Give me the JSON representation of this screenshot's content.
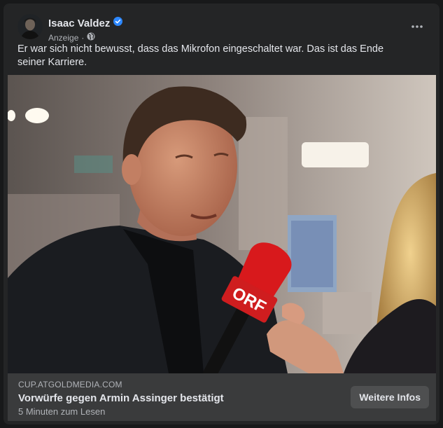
{
  "post": {
    "author": "Isaac Valdez",
    "meta_label": "Anzeige",
    "separator": "·",
    "body_text": "Er war sich nicht bewusst, dass das Mikrofon eingeschaltet war. Das ist das Ende seiner Karriere."
  },
  "link_preview": {
    "domain": "CUP.ATGOLDMEDIA.COM",
    "headline": "Vorwürfe gegen Armin Assinger bestätigt",
    "read_time": "5 Minuten zum Lesen",
    "cta_label": "Weitere Infos"
  },
  "image": {
    "mic_logo": "ORF"
  },
  "icons": {
    "verified": "verified-badge-icon",
    "audience": "globe-icon",
    "options": "more-horizontal-icon"
  },
  "colors": {
    "card_bg": "#242526",
    "page_bg": "#18191a",
    "text_primary": "#e4e6eb",
    "text_secondary": "#b0b3b8",
    "verified_blue": "#2d88ff",
    "footer_bg": "#3a3b3c",
    "mic_red": "#d8191c"
  }
}
